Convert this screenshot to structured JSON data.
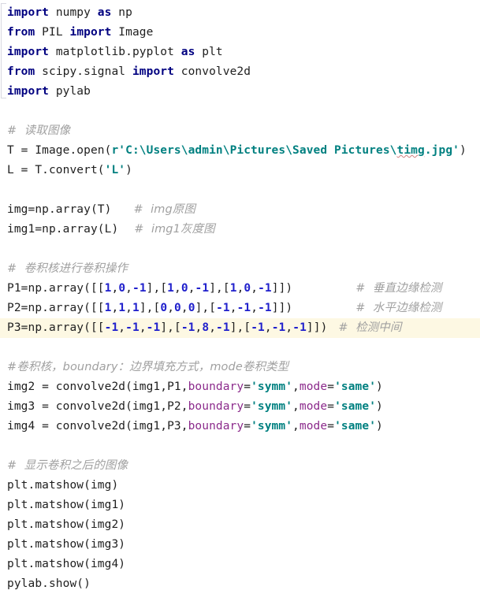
{
  "editor": {
    "background_color": "#ffffff",
    "current_line_highlight_color": "#fdf8e3",
    "colors": {
      "keyword": "#000080",
      "number": "#2020cc",
      "string": "#008080",
      "keyword_argument": "#8b2a8b",
      "comment": "#a0a0a0",
      "default_text": "#202020",
      "spellcheck_underline": "#d08080"
    }
  },
  "code": {
    "language": "python",
    "lines": [
      {
        "n": 1,
        "text": "import numpy as np"
      },
      {
        "n": 2,
        "text": "from PIL import Image"
      },
      {
        "n": 3,
        "text": "import matplotlib.pyplot as plt"
      },
      {
        "n": 4,
        "text": "from scipy.signal import convolve2d"
      },
      {
        "n": 5,
        "text": "import pylab"
      },
      {
        "n": 6,
        "text": ""
      },
      {
        "n": 7,
        "text": "# 读取图像"
      },
      {
        "n": 8,
        "text": "T = Image.open(r'C:\\Users\\admin\\Pictures\\Saved Pictures\\timg.jpg')"
      },
      {
        "n": 9,
        "text": "L = T.convert('L')"
      },
      {
        "n": 10,
        "text": ""
      },
      {
        "n": 11,
        "text": "img=np.array(T)   # img原图"
      },
      {
        "n": 12,
        "text": "img1=np.array(L)  # img1灰度图"
      },
      {
        "n": 13,
        "text": ""
      },
      {
        "n": 14,
        "text": "# 卷积核进行卷积操作"
      },
      {
        "n": 15,
        "text": "P1=np.array([[1,0,-1],[1,0,-1],[1,0,-1]])          # 垂直边缘检测"
      },
      {
        "n": 16,
        "text": "P2=np.array([[1,1,1],[0,0,0],[-1,-1,-1]])          # 水平边缘检测"
      },
      {
        "n": 17,
        "text": "P3=np.array([[-1,-1,-1],[-1,8,-1],[-1,-1,-1]])  # 检测中间",
        "current": true
      },
      {
        "n": 18,
        "text": ""
      },
      {
        "n": 19,
        "text": "#卷积核，boundary：边界填充方式，mode卷积类型"
      },
      {
        "n": 20,
        "text": "img2 = convolve2d(img1,P1,boundary='symm',mode='same')"
      },
      {
        "n": 21,
        "text": "img3 = convolve2d(img1,P2,boundary='symm',mode='same')"
      },
      {
        "n": 22,
        "text": "img4 = convolve2d(img1,P3,boundary='symm',mode='same')"
      },
      {
        "n": 23,
        "text": ""
      },
      {
        "n": 24,
        "text": "# 显示卷积之后的图像"
      },
      {
        "n": 25,
        "text": "plt.matshow(img)"
      },
      {
        "n": 26,
        "text": "plt.matshow(img1)"
      },
      {
        "n": 27,
        "text": "plt.matshow(img2)"
      },
      {
        "n": 28,
        "text": "plt.matshow(img3)"
      },
      {
        "n": 29,
        "text": "plt.matshow(img4)"
      },
      {
        "n": 30,
        "text": "pylab.show()"
      }
    ],
    "tokens": {
      "l1": {
        "kw1": "import",
        "id1": " numpy ",
        "kw2": "as",
        "id2": " np"
      },
      "l2": {
        "kw1": "from",
        "id1": " PIL ",
        "kw2": "import",
        "id2": " Image"
      },
      "l3": {
        "kw1": "import",
        "id1": " matplotlib.pyplot ",
        "kw2": "as",
        "id2": " plt"
      },
      "l4": {
        "kw1": "from",
        "id1": " scipy.signal ",
        "kw2": "import",
        "id2": " convolve2d"
      },
      "l5": {
        "kw1": "import",
        "id1": " pylab"
      },
      "l7": {
        "comment": "#  读取图像"
      },
      "l8": {
        "pre": "T = Image.open(",
        "str_prefix": "r",
        "str_open": "'C:\\Users\\admin\\Pictures\\Saved Pictures\\",
        "str_spell": "timg",
        "str_close": ".jpg'",
        "post": ")"
      },
      "l9": {
        "pre": "L = T.convert(",
        "str": "'L'",
        "post": ")"
      },
      "l11": {
        "code": "img=np.array(T)",
        "comment": "#  img原图"
      },
      "l12": {
        "code": "img1=np.array(L)",
        "comment": "#  img1灰度图"
      },
      "l14": {
        "comment": "#  卷积核进行卷积操作"
      },
      "l15": {
        "pre": "P1=np.array([[",
        "nums": [
          "1",
          "0",
          "-1",
          "1",
          "0",
          "-1",
          "1",
          "0",
          "-1"
        ],
        "comment": "#  垂直边缘检测"
      },
      "l16": {
        "pre": "P2=np.array([[",
        "nums": [
          "1",
          "1",
          "1",
          "0",
          "0",
          "0",
          "-1",
          "-1",
          "-1"
        ],
        "comment": "#  水平边缘检测"
      },
      "l17": {
        "pre": "P3=np.array([[",
        "nums": [
          "-1",
          "-1",
          "-1",
          "-1",
          "8",
          "-1",
          "-1",
          "-1",
          "-1"
        ],
        "comment": "#  检测中间"
      },
      "l19": {
        "comment": "#卷积核，boundary：边界填充方式，mode卷积类型"
      },
      "l20": {
        "lhs": "img2 = convolve2d(img1,P1,",
        "kwarg1": "boundary",
        "s1": "'symm'",
        "kwarg2": "mode",
        "s2": "'same'"
      },
      "l21": {
        "lhs": "img3 = convolve2d(img1,P2,",
        "kwarg1": "boundary",
        "s1": "'symm'",
        "kwarg2": "mode",
        "s2": "'same'"
      },
      "l22": {
        "lhs": "img4 = convolve2d(img1,P3,",
        "kwarg1": "boundary",
        "s1": "'symm'",
        "kwarg2": "mode",
        "s2": "'same'"
      },
      "l24": {
        "comment": "#  显示卷积之后的图像"
      },
      "l25": {
        "code": "plt.matshow(img)"
      },
      "l26": {
        "code": "plt.matshow(img1)"
      },
      "l27": {
        "code": "plt.matshow(img2)"
      },
      "l28": {
        "code": "plt.matshow(img3)"
      },
      "l29": {
        "code": "plt.matshow(img4)"
      },
      "l30": {
        "code": "pylab.show()"
      }
    }
  }
}
